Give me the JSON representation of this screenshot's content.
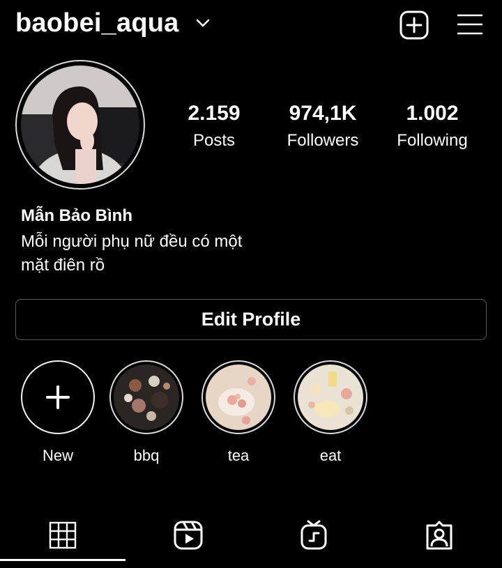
{
  "header": {
    "username": "baobei_aqua",
    "icons": [
      "chevron-down-icon",
      "add-post-icon",
      "menu-icon"
    ]
  },
  "stats": [
    {
      "value": "2.159",
      "label": "Posts"
    },
    {
      "value": "974,1K",
      "label": "Followers"
    },
    {
      "value": "1.002",
      "label": "Following"
    }
  ],
  "profile": {
    "display_name": "Mẫn Bảo Bình",
    "bio_line1": "Mỗi người phụ nữ đều có một",
    "bio_line2": "mặt điên rồ"
  },
  "edit_profile_label": "Edit Profile",
  "highlights": [
    {
      "label": "New"
    },
    {
      "label": "bbq"
    },
    {
      "label": "tea"
    },
    {
      "label": "eat"
    }
  ],
  "tabs": [
    "grid-icon",
    "reels-icon",
    "igtv-icon",
    "tagged-icon"
  ],
  "colors": {
    "background": "#000000",
    "text": "#ffffff",
    "border": "#5a5a5a"
  }
}
